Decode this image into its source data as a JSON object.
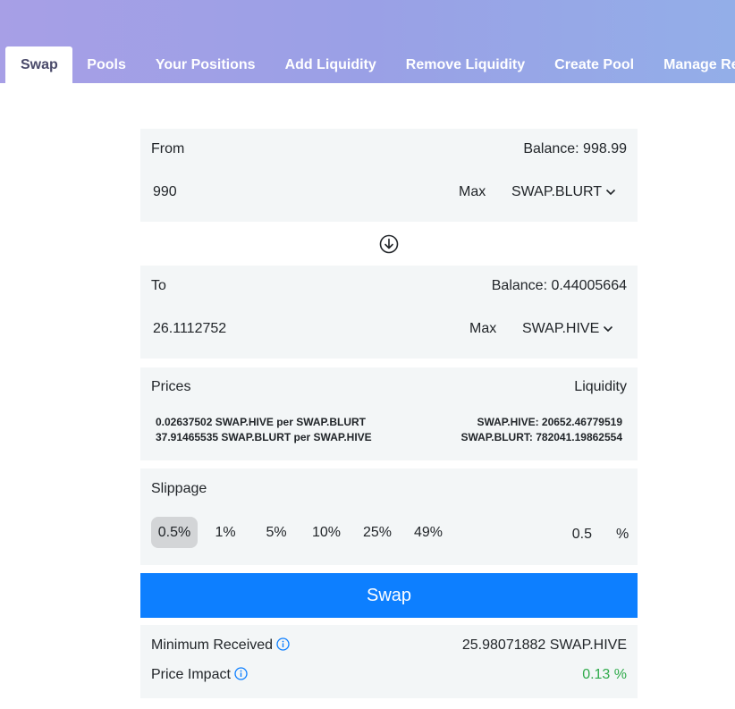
{
  "nav": {
    "tabs": [
      {
        "label": "Swap"
      },
      {
        "label": "Pools"
      },
      {
        "label": "Your Positions"
      },
      {
        "label": "Add Liquidity"
      },
      {
        "label": "Remove Liquidity"
      },
      {
        "label": "Create Pool"
      },
      {
        "label": "Manage Rewa"
      }
    ]
  },
  "from": {
    "label": "From",
    "balance": "Balance: 998.99",
    "amount": "990",
    "max_label": "Max",
    "token": "SWAP.BLURT"
  },
  "to": {
    "label": "To",
    "balance": "Balance: 0.44005664",
    "amount": "26.1112752",
    "max_label": "Max",
    "token": "SWAP.HIVE"
  },
  "prices": {
    "label": "Prices",
    "liquidity_label": "Liquidity",
    "price1": "0.02637502 SWAP.HIVE per SWAP.BLURT",
    "price2": "37.91465535 SWAP.BLURT per SWAP.HIVE",
    "liquidity1": "SWAP.HIVE: 20652.46779519",
    "liquidity2": "SWAP.BLURT: 782041.19862554"
  },
  "slippage": {
    "label": "Slippage",
    "options": [
      "0.5%",
      "1%",
      "5%",
      "10%",
      "25%",
      "49%"
    ],
    "selected_index": 0,
    "custom_value": "0.5",
    "unit": "%"
  },
  "swap_button": "Swap",
  "summary": {
    "min_received_label": "Minimum Received",
    "min_received_value": "25.98071882 SWAP.HIVE",
    "price_impact_label": "Price Impact",
    "price_impact_value": "0.13 %"
  },
  "colors": {
    "accent": "#0d7fff",
    "positive": "#2eaa4a",
    "panel": "#f3f6f7"
  }
}
